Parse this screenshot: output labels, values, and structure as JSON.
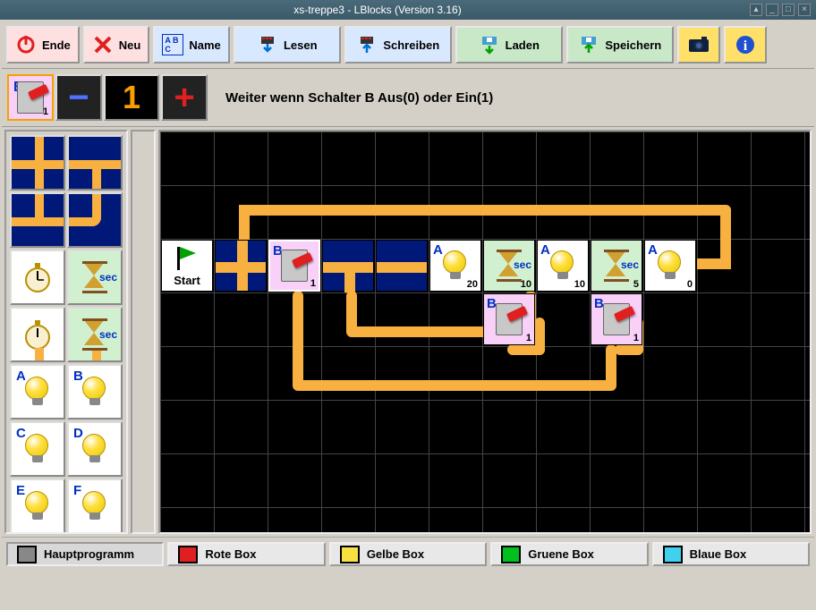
{
  "window": {
    "title": "xs-treppe3 - LBlocks (Version 3.16)"
  },
  "toolbar": {
    "ende": "Ende",
    "neu": "Neu",
    "name": "Name",
    "lesen": "Lesen",
    "schreiben": "Schreiben",
    "laden": "Laden",
    "speichern": "Speichern"
  },
  "param": {
    "switch_letter": "B",
    "switch_corner": "1",
    "value": "1",
    "description": "Weiter wenn Schalter B Aus(0) oder Ein(1)"
  },
  "palette": {
    "timer_sec": "sec",
    "lamp_A": "A",
    "lamp_B": "B",
    "lamp_C": "C",
    "lamp_D": "D",
    "lamp_E": "E",
    "lamp_F": "F"
  },
  "canvas": {
    "start_label": "Start",
    "blocks": {
      "switchB1": {
        "letter": "B",
        "val": "1"
      },
      "lampA20": {
        "letter": "A",
        "val": "20"
      },
      "timer10a": {
        "sec": "sec",
        "val": "10"
      },
      "lampA10": {
        "letter": "A",
        "val": "10"
      },
      "timer5": {
        "sec": "sec",
        "val": "5"
      },
      "lampA0": {
        "letter": "A",
        "val": "0"
      },
      "switchB1b": {
        "letter": "B",
        "val": "1"
      },
      "switchB1c": {
        "letter": "B",
        "val": "1"
      }
    }
  },
  "tabs": {
    "haupt": "Hauptprogramm",
    "rote": "Rote Box",
    "gelbe": "Gelbe Box",
    "gruene": "Gruene Box",
    "blaue": "Blaue Box"
  }
}
